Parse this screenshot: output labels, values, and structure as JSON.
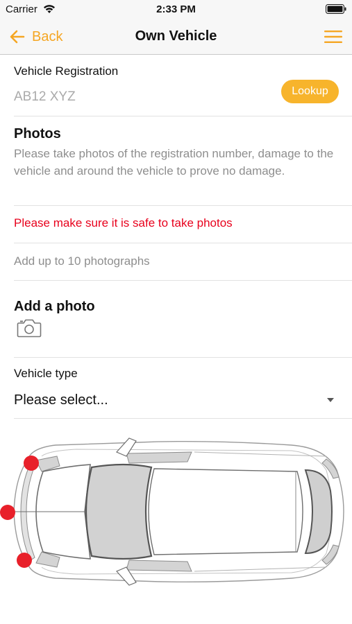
{
  "status_bar": {
    "carrier": "Carrier",
    "time": "2:33 PM",
    "icons": [
      "wifi-icon",
      "battery-icon"
    ]
  },
  "nav": {
    "back_label": "Back",
    "title": "Own Vehicle",
    "back_icon": "back-arrow-icon",
    "menu_icon": "hamburger-menu-icon"
  },
  "registration": {
    "label": "Vehicle Registration",
    "placeholder": "AB12 XYZ",
    "lookup_label": "Lookup"
  },
  "photos": {
    "heading": "Photos",
    "description": "Please take photos of the registration number, damage to the vehicle and around the vehicle to prove no damage.",
    "warning": "Please make sure it is safe to take photos",
    "limit_text": "Add up to 10 photographs",
    "add_heading": "Add a photo",
    "add_icon": "camera-icon"
  },
  "vehicle_type": {
    "label": "Vehicle type",
    "selected": "Please select..."
  },
  "diagram": {
    "icon": "car-top-view-diagram",
    "markers": [
      "front-left",
      "front-center",
      "front-right"
    ]
  },
  "colors": {
    "accent": "#f5a623",
    "lookup_button": "#f7b42c",
    "warning": "#e8001c",
    "marker": "#e8202a",
    "secondary_text": "#8e8e8e"
  }
}
